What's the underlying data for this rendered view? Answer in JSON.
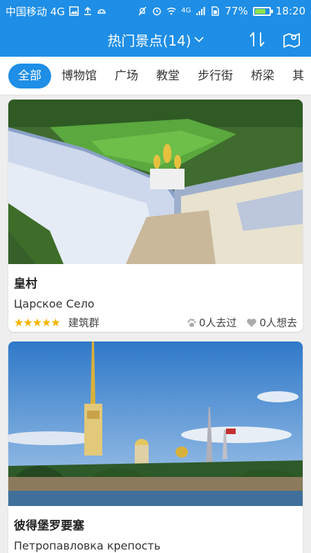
{
  "status_bar": {
    "carrier": "中国移动 4G",
    "network": "4G",
    "battery": "77%",
    "battery_level": 0.77,
    "time": "18:20"
  },
  "header": {
    "title": "热门景点(14)"
  },
  "tabs": [
    {
      "label": "全部",
      "active": true
    },
    {
      "label": "博物馆",
      "active": false
    },
    {
      "label": "广场",
      "active": false
    },
    {
      "label": "教堂",
      "active": false
    },
    {
      "label": "步行街",
      "active": false
    },
    {
      "label": "桥梁",
      "active": false
    },
    {
      "label": "其",
      "active": false
    }
  ],
  "attractions": [
    {
      "name": "皇村",
      "local_name": "Царское Село",
      "rating": "★★★★★",
      "category": "建筑群",
      "visited": "0人去过",
      "wanted": "0人想去"
    },
    {
      "name": "彼得堡罗要塞",
      "local_name": "Петропавловка крепость"
    }
  ],
  "colors": {
    "primary": "#1e8ee6",
    "star": "#f5b400"
  }
}
